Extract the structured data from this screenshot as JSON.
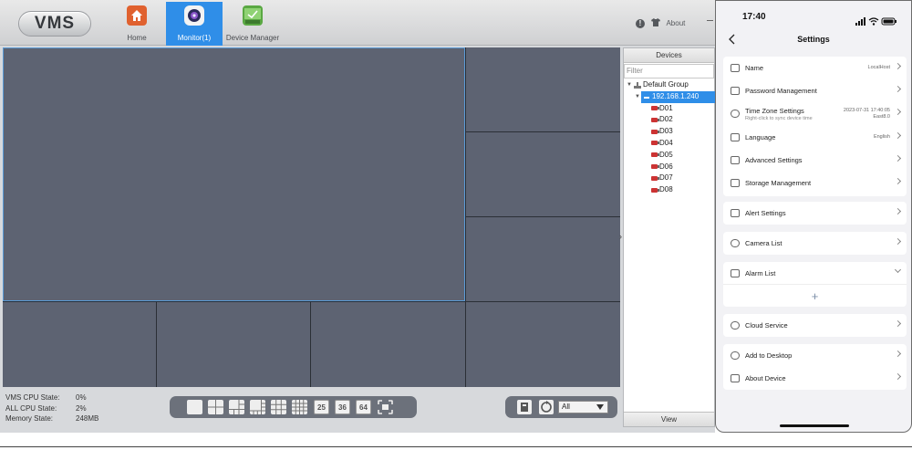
{
  "vms": {
    "logo": "VMS",
    "nav": [
      {
        "label": "Home",
        "icon": "home-icon"
      },
      {
        "label": "Monitor(1)",
        "icon": "monitor-icon",
        "active": true
      },
      {
        "label": "Device Manager",
        "icon": "device-manager-icon"
      }
    ],
    "about_label": "About",
    "stats": [
      {
        "key": "VMS CPU State:",
        "value": "0%"
      },
      {
        "key": "ALL CPU State:",
        "value": "2%"
      },
      {
        "key": "Memory State:",
        "value": "248MB"
      }
    ],
    "layout_numbers": [
      "25",
      "36",
      "64"
    ],
    "stream_select": "All",
    "devices": {
      "title": "Devices",
      "filter_placeholder": "Filter",
      "group": "Default Group",
      "ip": "192.168.1.240",
      "channels": [
        "D01",
        "D02",
        "D03",
        "D04",
        "D05",
        "D06",
        "D07",
        "D08"
      ],
      "footer": "View"
    },
    "colors": {
      "accent": "#2f8ee8",
      "tile": "#5d6372",
      "home": "#e0612f",
      "device": "#5aa843"
    }
  },
  "phone": {
    "time": "17:40",
    "title": "Settings",
    "name": {
      "label": "Name",
      "value": "LocalHost"
    },
    "password": {
      "label": "Password Management"
    },
    "timezone": {
      "label": "Time Zone Settings",
      "sub": "Right-click to sync device time",
      "value1": "2023-07-31 17:40:05",
      "value2": "East8.0"
    },
    "language": {
      "label": "Language",
      "value": "English"
    },
    "advanced": {
      "label": "Advanced Settings"
    },
    "storage": {
      "label": "Storage Management"
    },
    "alert": {
      "label": "Alert Settings"
    },
    "camera": {
      "label": "Camera List"
    },
    "alarm": {
      "label": "Alarm List",
      "add": "+"
    },
    "cloud": {
      "label": "Cloud Service"
    },
    "desktop": {
      "label": "Add to Desktop"
    },
    "about": {
      "label": "About Device"
    }
  }
}
